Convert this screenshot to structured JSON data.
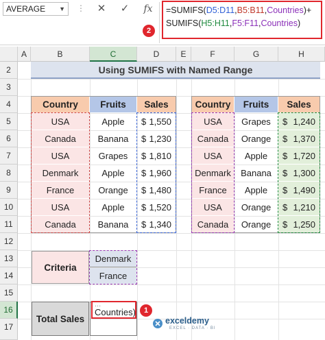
{
  "formula_bar": {
    "name_box": "AVERAGE",
    "more_icon": "⋮",
    "cancel_icon": "✕",
    "enter_icon": "✓",
    "fx_label": "fx",
    "line1": [
      "=SUMIFS(",
      "D5:D11",
      ",",
      "B5:B11",
      ",",
      "Countries",
      ")+"
    ],
    "line2": [
      "SUMIFS(",
      "H5:H11",
      ",",
      "F5:F11",
      ",",
      "Countries",
      ")"
    ],
    "callout": "2"
  },
  "columns": [
    "A",
    "B",
    "C",
    "D",
    "E",
    "F",
    "G",
    "H"
  ],
  "rows": [
    "1",
    "2",
    "3",
    "4",
    "5",
    "6",
    "7",
    "8",
    "9",
    "10",
    "11",
    "12",
    "13",
    "14",
    "15",
    "16",
    "17"
  ],
  "sheet_title": "Using SUMIFS with Named Range",
  "table1": {
    "headers": [
      "Country",
      "Fruits",
      "Sales"
    ],
    "rows": [
      [
        "USA",
        "Apple",
        "1,550"
      ],
      [
        "Canada",
        "Banana",
        "1,230"
      ],
      [
        "USA",
        "Grapes",
        "1,810"
      ],
      [
        "Denmark",
        "Apple",
        "1,960"
      ],
      [
        "France",
        "Orange",
        "1,480"
      ],
      [
        "USA",
        "Apple",
        "1,520"
      ],
      [
        "Canada",
        "Banana",
        "1,340"
      ]
    ]
  },
  "table2": {
    "headers": [
      "Country",
      "Fruits",
      "Sales"
    ],
    "rows": [
      [
        "USA",
        "Grapes",
        "1,240"
      ],
      [
        "Canada",
        "Orange",
        "1,370"
      ],
      [
        "USA",
        "Apple",
        "1,720"
      ],
      [
        "Denmark",
        "Banana",
        "1,300"
      ],
      [
        "France",
        "Apple",
        "1,490"
      ],
      [
        "USA",
        "Orange",
        "1,210"
      ],
      [
        "Canada",
        "Orange",
        "1,250"
      ]
    ]
  },
  "currency": "$",
  "criteria": {
    "label": "Criteria",
    "values": [
      "Denmark",
      "France"
    ]
  },
  "total": {
    "label": "Total Sales",
    "edit_text_top": "...",
    "edit_text": "Countries)",
    "callout": "1"
  },
  "watermark": {
    "brand": "exceldemy",
    "tagline": "EXCEL · DATA · BI"
  },
  "colors": {
    "orange_header": "#f8cbad",
    "blue_header": "#b4c6e7",
    "light_pink": "#fbe5e5",
    "light_green": "#e2efda",
    "red_accent": "#e0262d"
  }
}
